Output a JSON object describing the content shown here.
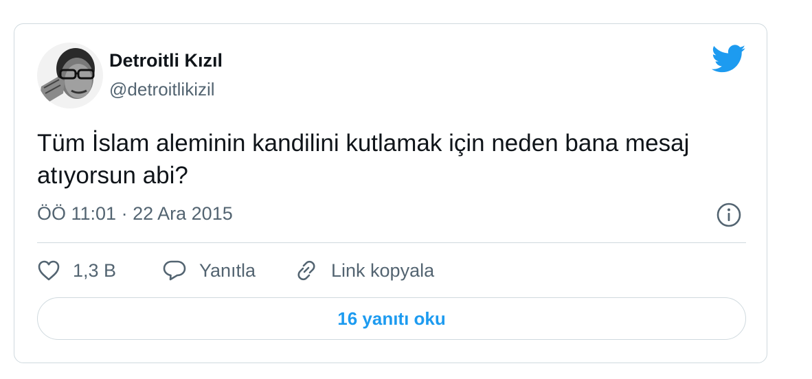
{
  "tweet": {
    "author": {
      "name": "Detroitli Kızıl",
      "handle": "@detroitlikizil"
    },
    "text": "Tüm İslam aleminin kandilini kutlamak için neden bana mesaj atıyorsun abi?",
    "time": "ÖÖ 11:01",
    "separator": "·",
    "date": "22 Ara 2015",
    "actions": {
      "like_count": "1,3 B",
      "reply_label": "Yanıtla",
      "copy_link_label": "Link kopyala"
    },
    "read_replies_label": "16 yanıtı oku"
  },
  "icons": {
    "brand": "twitter-bird-icon",
    "info": "info-circle-icon",
    "like": "heart-icon",
    "reply": "speech-bubble-icon",
    "copy_link": "link-icon"
  },
  "colors": {
    "brand": "#1d9bf0",
    "text_primary": "#0f1419",
    "text_secondary": "#536471",
    "border": "#cfd9de"
  }
}
